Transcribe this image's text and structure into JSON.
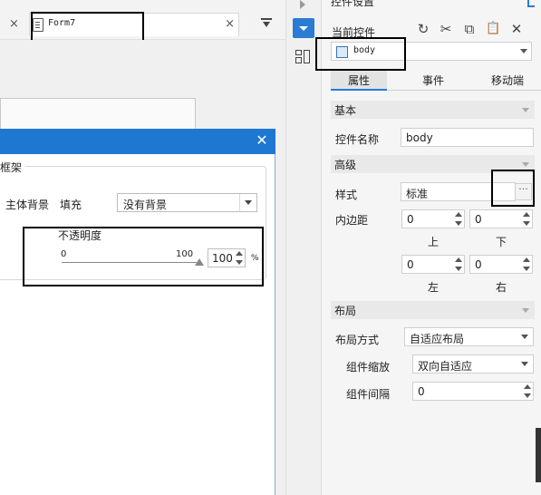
{
  "workspace": {
    "tab_bar": {
      "left_close_glyph": "×",
      "active_tab_label": "Form7",
      "active_tab_close_glyph": "×",
      "overflow_glyph": "▾"
    }
  },
  "dialog": {
    "close_glyph": "✕",
    "frame_title": "框架",
    "background_label": "主体背景",
    "fill_label": "填充",
    "background_select_value": "没有背景",
    "opacity_label": "不透明度",
    "opacity_min": "0",
    "opacity_max": "100",
    "opacity_value": "100",
    "opacity_unit": "%",
    "opacity_level_percent": 100
  },
  "panel": {
    "title": "控件设置",
    "current_control_label": "当前控件",
    "toolbar_glyphs": {
      "refresh": "↻",
      "cut": "✂",
      "copy": "⧉",
      "paste": "📋",
      "delete": "✕"
    },
    "current_control_value": "body",
    "tabs": [
      "属性",
      "事件",
      "移动端"
    ],
    "active_tab_index": 0,
    "sections": {
      "basic": "基本",
      "advanced": "高级",
      "layout": "布局"
    },
    "fields": {
      "control_name_label": "控件名称",
      "control_name_value": "body",
      "style_label": "样式",
      "style_value": "标准",
      "style_more_glyph": "···",
      "padding_label": "内边距",
      "padding_top": "0",
      "padding_bottom": "0",
      "padding_left": "0",
      "padding_right": "0",
      "top_label": "上",
      "bottom_label": "下",
      "left_label": "左",
      "right_label": "右",
      "layout_mode_label": "布局方式",
      "layout_mode_value": "自适应布局",
      "component_scale_label": "组件缩放",
      "component_scale_value": "双向自适应",
      "component_gap_label": "组件间隔",
      "component_gap_value": "0"
    }
  }
}
